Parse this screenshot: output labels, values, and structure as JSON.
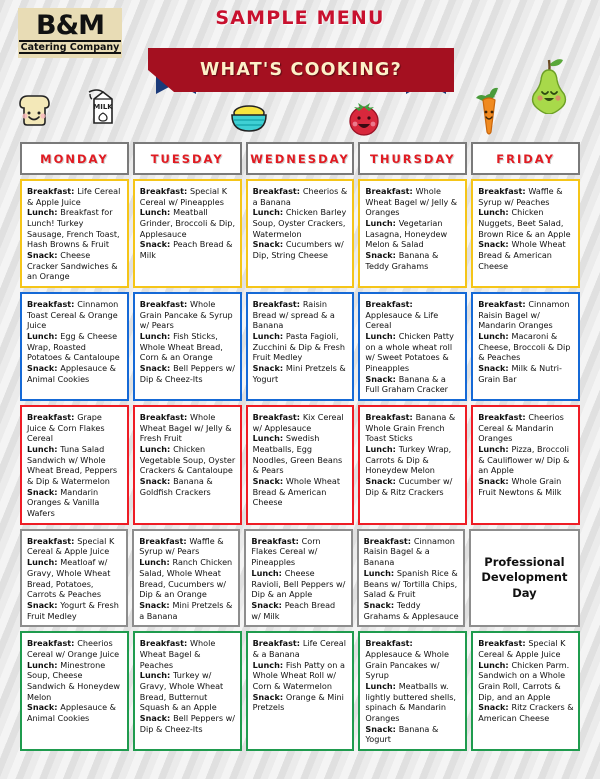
{
  "brand": {
    "logo_main": "B&M",
    "logo_sub": "Catering Company"
  },
  "header": {
    "title": "SAMPLE MENU",
    "banner_text": "WHAT'S COOKING?",
    "icons": [
      "bread-icon",
      "milk-carton-icon",
      "cereal-bowl-icon",
      "tomato-icon",
      "carrot-icon",
      "pear-icon"
    ],
    "colors": {
      "title_red": "#c8102e",
      "banner_red": "#a41020",
      "banner_text_cream": "#fdf0c8",
      "banner_tail_navy": "#1a3a7a",
      "logo_tan": "#e8dcb5"
    }
  },
  "days": [
    "MONDAY",
    "TUESDAY",
    "WEDNESDAY",
    "THURSDAY",
    "FRIDAY"
  ],
  "week_colors": {
    "week1": "#f5c518",
    "week2": "#1569d6",
    "week3": "#ee1c25",
    "week4": "#8d8d8d",
    "week5": "#1f9b4e"
  },
  "labels": {
    "breakfast": "Breakfast:",
    "lunch": "Lunch:",
    "snack": "Snack:"
  },
  "weeks": [
    {
      "border_color": "#f5c518",
      "cells": [
        {
          "breakfast": "Life Cereal & Apple Juice",
          "lunch": "Breakfast for Lunch! Turkey Sausage, French Toast, Hash Browns & Fruit",
          "snack": "Cheese Cracker Sandwiches & an Orange"
        },
        {
          "breakfast": "Special K Cereal w/ Pineapples",
          "lunch": "Meatball Grinder, Broccoli & Dip, Applesauce",
          "snack": "Peach Bread & Milk"
        },
        {
          "breakfast": "Cheerios & a Banana",
          "lunch": "Chicken Barley Soup, Oyster Crackers, Watermelon",
          "snack": "Cucumbers w/ Dip, String Cheese"
        },
        {
          "breakfast": "Whole Wheat Bagel w/ Jelly & Oranges",
          "lunch": "Vegetarian Lasagna, Honeydew Melon & Salad",
          "snack": "Banana & Teddy Grahams"
        },
        {
          "breakfast": "Waffle & Syrup w/ Peaches",
          "lunch": "Chicken Nuggets, Beet Salad, Brown Rice & an Apple",
          "snack": "Whole Wheat Bread & American Cheese"
        }
      ]
    },
    {
      "border_color": "#1569d6",
      "cells": [
        {
          "breakfast": "Cinnamon Toast Cereal & Orange Juice",
          "lunch": "Egg & Cheese Wrap, Roasted Potatoes & Cantaloupe",
          "snack": "Applesauce & Animal Cookies"
        },
        {
          "breakfast": "Whole Grain Pancake & Syrup w/ Pears",
          "lunch": "Fish Sticks, Whole Wheat Bread, Corn & an Orange",
          "snack": "Bell Peppers w/ Dip & Cheez-Its"
        },
        {
          "breakfast": "Raisin Bread w/ spread & a Banana",
          "lunch": "Pasta Fagioli, Zucchini & Dip & Fresh Fruit Medley",
          "snack": "Mini Pretzels & Yogurt"
        },
        {
          "breakfast": "Applesauce & Life Cereal",
          "lunch": "Chicken Patty on a whole wheat roll w/ Sweet Potatoes & Pineapples",
          "snack": "Banana & a Full Graham Cracker"
        },
        {
          "breakfast": "Cinnamon Raisin Bagel w/ Mandarin Oranges",
          "lunch": "Macaroni & Cheese, Broccoli & Dip & Peaches",
          "snack": "Milk & Nutri-Grain Bar"
        }
      ]
    },
    {
      "border_color": "#ee1c25",
      "cells": [
        {
          "breakfast": "Grape Juice & Corn Flakes Cereal",
          "lunch": "Tuna Salad Sandwich w/ Whole Wheat Bread, Peppers & Dip & Watermelon",
          "snack": "Mandarin Oranges & Vanilla Wafers"
        },
        {
          "breakfast": "Whole Wheat Bagel w/ Jelly & Fresh Fruit",
          "lunch": "Chicken Vegetable Soup, Oyster Crackers & Cantaloupe",
          "snack": "Banana & Goldfish Crackers"
        },
        {
          "breakfast": "Kix Cereal w/ Applesauce",
          "lunch": "Swedish Meatballs, Egg Noodles, Green Beans & Pears",
          "snack": "Whole Wheat Bread & American Cheese"
        },
        {
          "breakfast": "Banana & Whole Grain French Toast Sticks",
          "lunch": "Turkey Wrap, Carrots & Dip & Honeydew Melon",
          "snack": "Cucumber w/ Dip & Ritz Crackers"
        },
        {
          "breakfast": "Cheerios Cereal & Mandarin Oranges",
          "lunch": "Pizza, Broccoli & Cauliflower w/ Dip & an Apple",
          "snack": "Whole Grain Fruit Newtons & Milk"
        }
      ]
    },
    {
      "border_color": "#8d8d8d",
      "cells": [
        {
          "breakfast": "Special K Cereal & Apple Juice",
          "lunch": "Meatloaf w/ Gravy, Whole Wheat Bread, Potatoes, Carrots & Peaches",
          "snack": "Yogurt & Fresh Fruit Medley"
        },
        {
          "breakfast": "Waffle & Syrup w/ Pears",
          "lunch": "Ranch Chicken Salad, Whole Wheat Bread, Cucumbers w/ Dip & an Orange",
          "snack": "Mini Pretzels & a Banana"
        },
        {
          "breakfast": "Corn Flakes Cereal w/ Pineapples",
          "lunch": "Cheese Ravioli, Bell Peppers w/ Dip & an Apple",
          "snack": "Peach Bread w/ Milk"
        },
        {
          "breakfast": "Cinnamon Raisin Bagel & a Banana",
          "lunch": "Spanish Rice & Beans w/ Tortilla Chips, Salad & Fruit",
          "snack": "Teddy Grahams & Applesauce"
        },
        {
          "special": "Professional Development Day"
        }
      ]
    },
    {
      "border_color": "#1f9b4e",
      "cells": [
        {
          "breakfast": "Cheerios Cereal w/ Orange Juice",
          "lunch": "Minestrone Soup, Cheese Sandwich & Honeydew Melon",
          "snack": "Applesauce & Animal Cookies"
        },
        {
          "breakfast": "Whole Wheat Bagel & Peaches",
          "lunch": "Turkey w/ Gravy, Whole Wheat Bread, Butternut Squash & an Apple",
          "snack": "Bell Peppers w/ Dip & Cheez-Its"
        },
        {
          "breakfast": "Life Cereal & a Banana",
          "lunch": "Fish Patty on a Whole Wheat Roll w/ Corn & Watermelon",
          "snack": "Orange & Mini Pretzels"
        },
        {
          "breakfast": "Applesauce & Whole Grain Pancakes w/ Syrup",
          "lunch": "Meatballs w. lightly buttered shells, spinach & Mandarin Oranges",
          "snack": "Banana & Yogurt"
        },
        {
          "breakfast": "Special K Cereal & Apple Juice",
          "lunch": "Chicken Parm. Sandwich on a Whole Grain Roll, Carrots & Dip, and an Apple",
          "snack": "Ritz Crackers & American Cheese"
        }
      ]
    }
  ]
}
